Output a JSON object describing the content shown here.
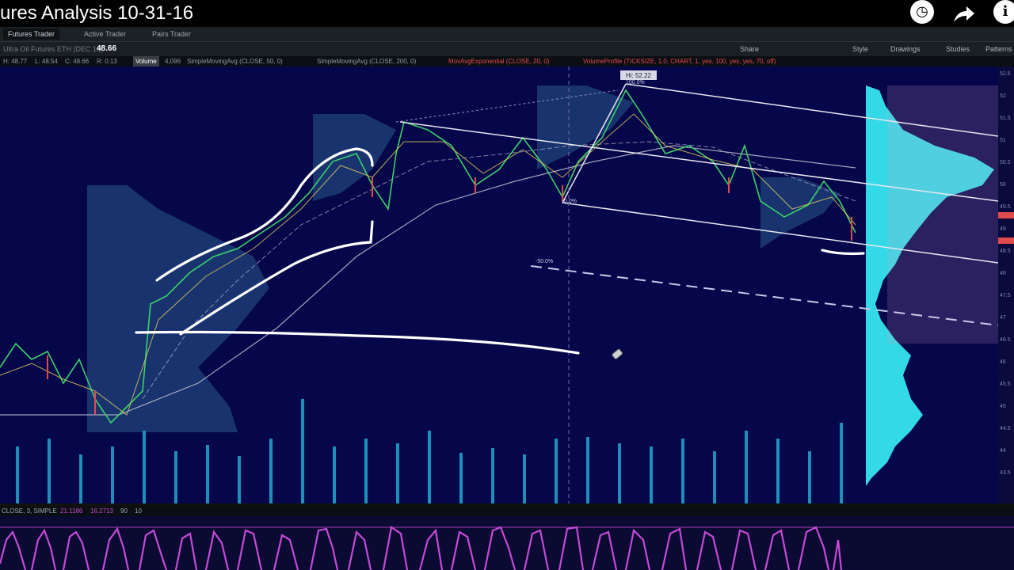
{
  "video": {
    "title": "ures Analysis 10-31-16",
    "icons": [
      "clock-icon",
      "share-arrow-icon",
      "info-icon"
    ]
  },
  "toolbar": {
    "tabs": [
      "Futures Trader",
      "Active Trader",
      "Pairs Trader"
    ],
    "right_items": [
      "Share",
      "Style",
      "Drawings",
      "Studies",
      "Patterns"
    ]
  },
  "quote": {
    "symbol": "Ultra Oil Futures ETH (DEC 16)",
    "price": "48.66",
    "values": [
      "H: 48.77",
      "L: 48.54",
      "C: 48.66",
      "R: 0.13"
    ],
    "volume_label": "Volume",
    "volume_value": "4,096"
  },
  "studies": [
    "SimpleMovingAvg (CLOSE, 50, 0)",
    "SimpleMovingAvg (CLOSE, 200, 0)",
    "MovAvgExponential (CLOSE, 20, 0)",
    "VolumeProfile (TICKSIZE, 1.0, CHART, 1, yes, 100, yes, yes, 70, off)"
  ],
  "chart_labels": {
    "high": "Hi: 52.22",
    "fib_top": "100.0%",
    "fib_bottom": "0.0%",
    "fib_mid": "-50.0%"
  },
  "price_axis": [
    "52.5",
    "52",
    "51.5",
    "51",
    "50.5",
    "50",
    "49.5",
    "49",
    "48.5",
    "48",
    "47.5",
    "47",
    "46.5",
    "46",
    "45.5",
    "45",
    "44.5",
    "44",
    "43.5"
  ],
  "lower_study": {
    "label": "CLOSE, 3, SIMPLE",
    "values": [
      "21.1186",
      "16.2713",
      "90",
      "10"
    ]
  },
  "colors": {
    "chart_bg": "#06064a",
    "profile": "#33d9e6",
    "volume": "#1d8fb8",
    "oscillator": "#c64ad6",
    "annotation": "#ffffff"
  }
}
